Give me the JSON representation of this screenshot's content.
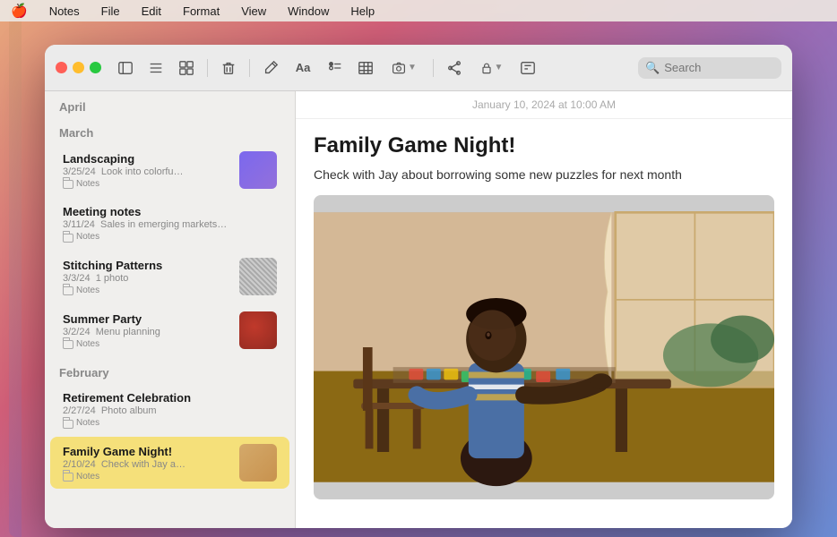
{
  "menubar": {
    "apple": "🍎",
    "items": [
      {
        "id": "notes",
        "label": "Notes"
      },
      {
        "id": "file",
        "label": "File"
      },
      {
        "id": "edit",
        "label": "Edit"
      },
      {
        "id": "format",
        "label": "Format"
      },
      {
        "id": "view",
        "label": "View"
      },
      {
        "id": "window",
        "label": "Window"
      },
      {
        "id": "help",
        "label": "Help"
      }
    ]
  },
  "toolbar": {
    "buttons": [
      {
        "id": "sidebar-toggle",
        "icon": "sidebar"
      },
      {
        "id": "list-view",
        "icon": "list"
      },
      {
        "id": "gallery-view",
        "icon": "gallery"
      },
      {
        "id": "delete",
        "icon": "trash"
      },
      {
        "id": "new-note",
        "icon": "compose"
      },
      {
        "id": "text-format",
        "icon": "Aa"
      },
      {
        "id": "checklist",
        "icon": "checklist"
      },
      {
        "id": "table",
        "icon": "table"
      },
      {
        "id": "attachment",
        "icon": "photo"
      },
      {
        "id": "share",
        "icon": "share"
      },
      {
        "id": "lock",
        "icon": "lock"
      },
      {
        "id": "more",
        "icon": "more"
      }
    ],
    "search_placeholder": "Search"
  },
  "sidebar": {
    "sections": [
      {
        "id": "april",
        "label": "April",
        "notes": []
      },
      {
        "id": "march",
        "label": "March",
        "notes": [
          {
            "id": "landscaping",
            "title": "Landscaping",
            "date": "3/25/24",
            "preview": "Look into colorfu…",
            "tag": "Notes",
            "has_thumb": true,
            "thumb_class": "thumb-purple",
            "selected": false
          },
          {
            "id": "meeting-notes",
            "title": "Meeting notes",
            "date": "3/11/24",
            "preview": "Sales in emerging markets…",
            "tag": "Notes",
            "has_thumb": false,
            "selected": false
          },
          {
            "id": "stitching-patterns",
            "title": "Stitching Patterns",
            "date": "3/3/24",
            "preview": "1 photo",
            "tag": "Notes",
            "has_thumb": true,
            "thumb_class": "thumb-gray",
            "selected": false
          },
          {
            "id": "summer-party",
            "title": "Summer Party",
            "date": "3/2/24",
            "preview": "Menu planning",
            "tag": "Notes",
            "has_thumb": true,
            "thumb_class": "thumb-red",
            "selected": false
          }
        ]
      },
      {
        "id": "february",
        "label": "February",
        "notes": [
          {
            "id": "retirement-celebration",
            "title": "Retirement Celebration",
            "date": "2/27/24",
            "preview": "Photo album",
            "tag": "Notes",
            "has_thumb": false,
            "selected": false
          },
          {
            "id": "family-game-night",
            "title": "Family Game Night!",
            "date": "2/10/24",
            "preview": "Check with Jay a…",
            "tag": "Notes",
            "has_thumb": true,
            "thumb_class": "thumb-tan",
            "selected": true
          }
        ]
      }
    ]
  },
  "editor": {
    "date": "January 10, 2024 at 10:00 AM",
    "title": "Family Game Night!",
    "body": "Check with Jay about borrowing some new puzzles for next month"
  }
}
